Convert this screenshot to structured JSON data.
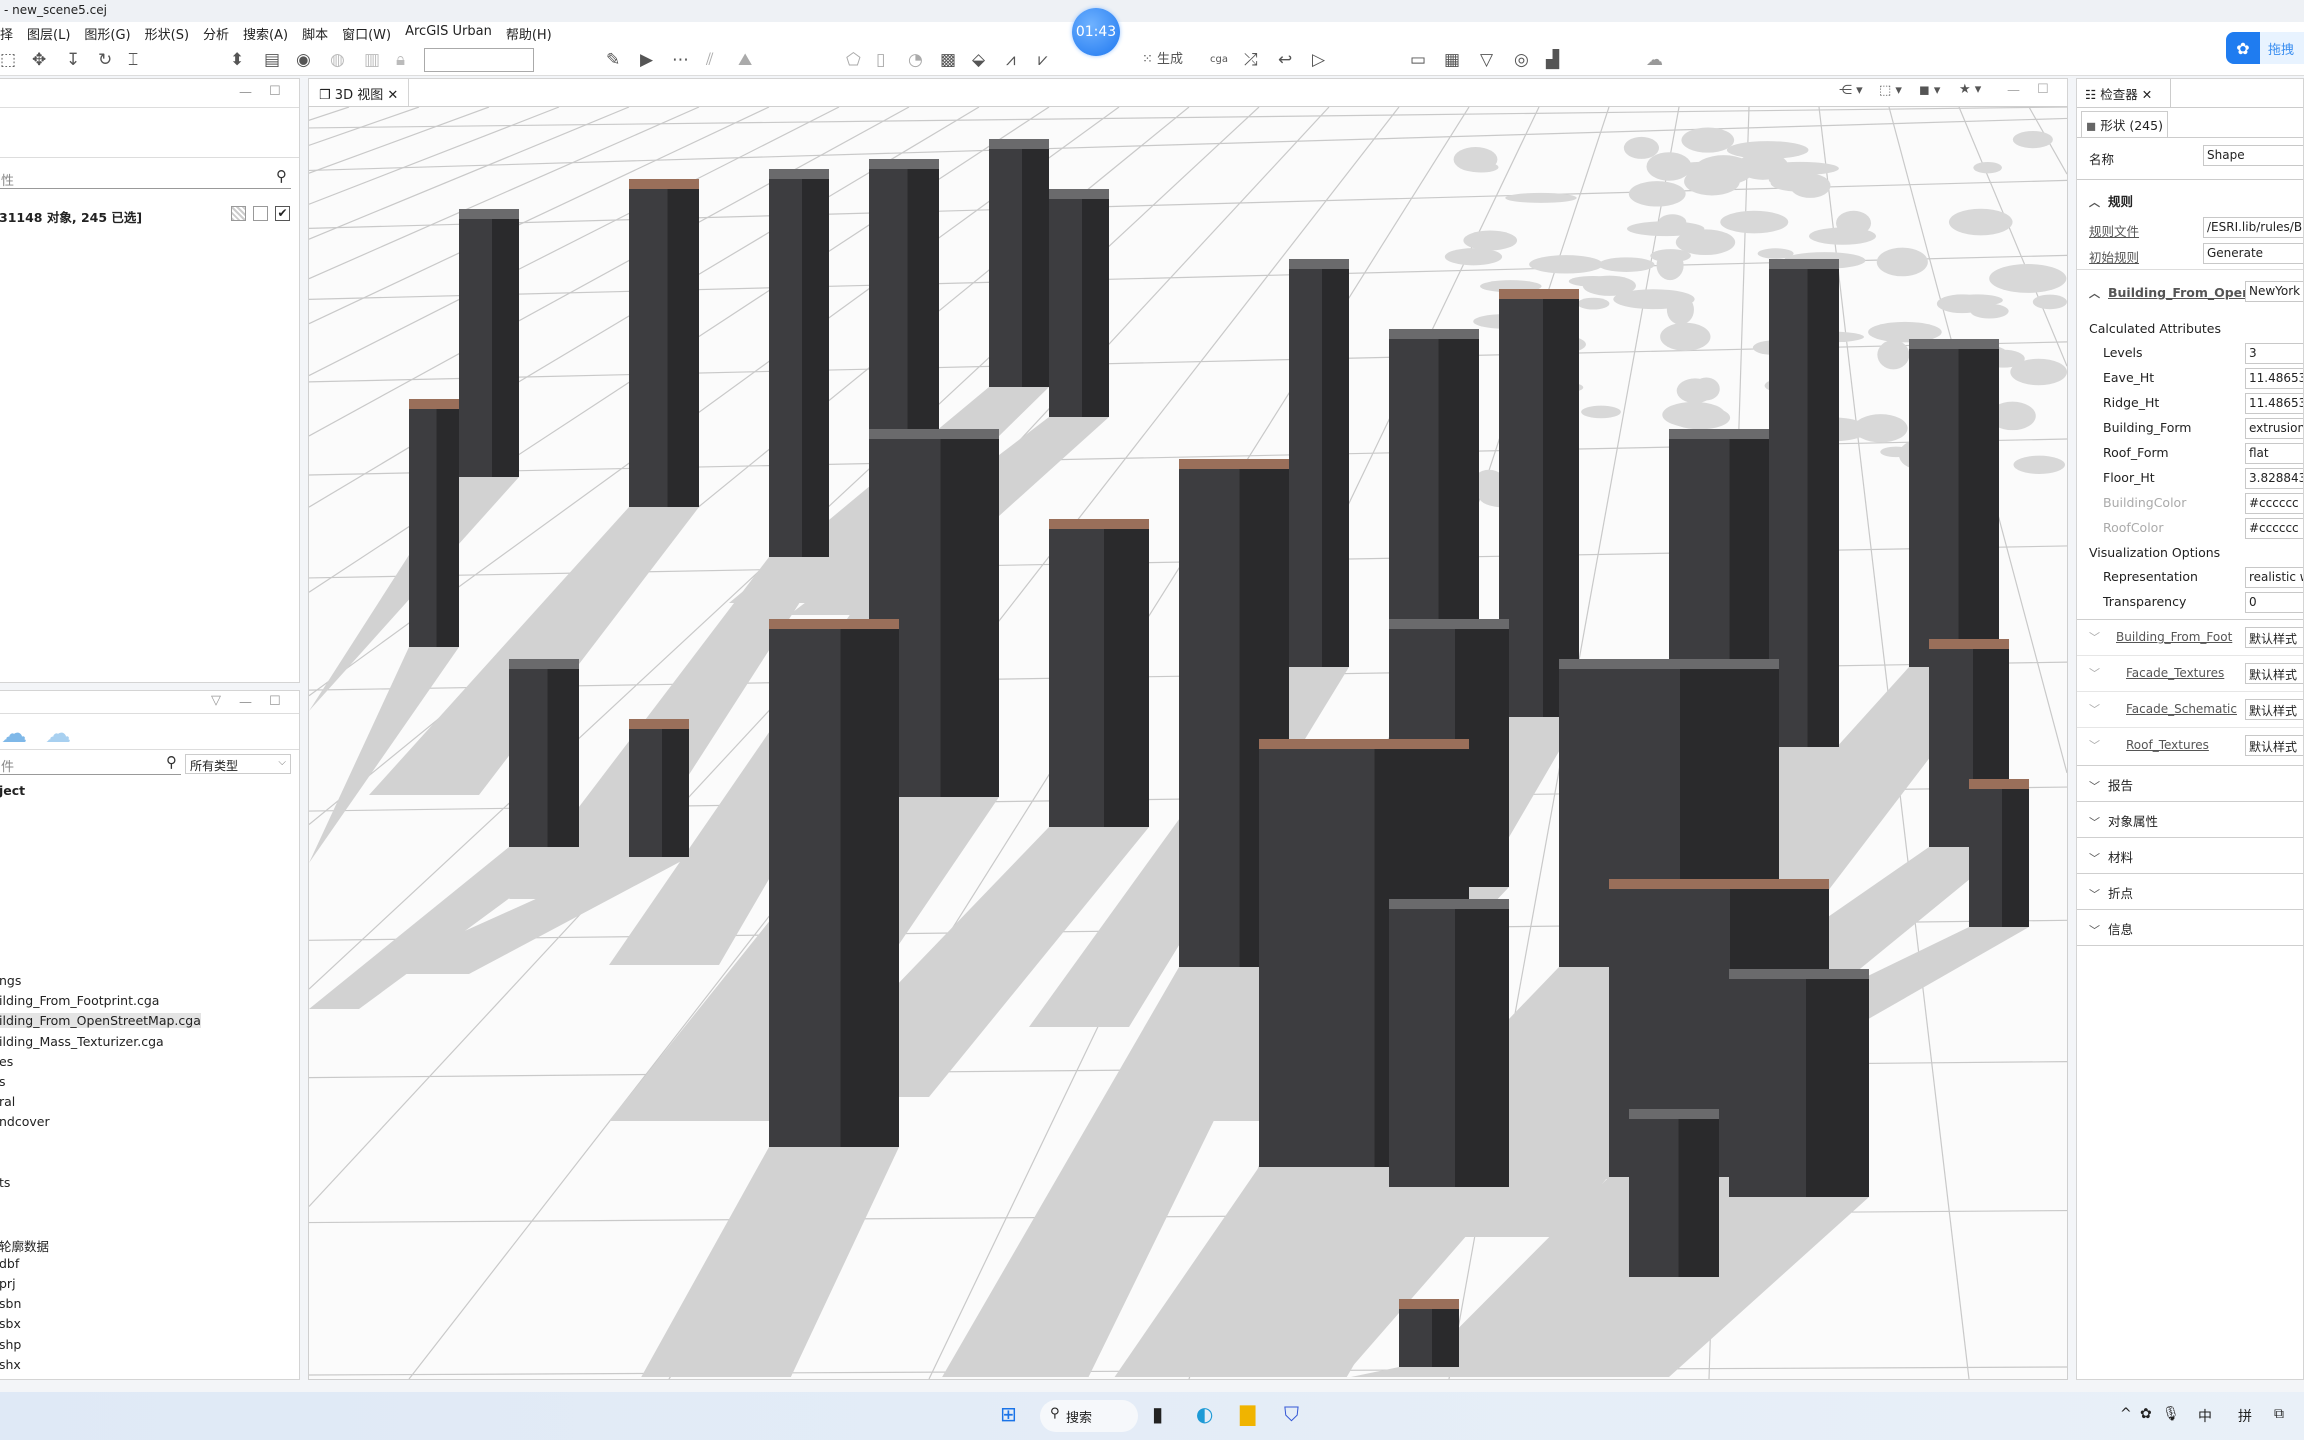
{
  "window": {
    "title": "- new_scene5.cej",
    "timer": "01:43"
  },
  "menu": [
    "择",
    "图层(L)",
    "图形(G)",
    "形状(S)",
    "分析",
    "搜索(A)",
    "脚本",
    "窗口(W)",
    "ArcGIS Urban",
    "帮助(H)"
  ],
  "toolbar": {
    "icons": [
      "frame-icon",
      "move-icon",
      "drop-icon",
      "rotate-icon",
      "fit-icon",
      "orbit-icon",
      "layers-icon",
      "tumble-icon",
      "globe-icon",
      "snap-icon",
      "lock-icon",
      "draw-polygon-icon",
      "select-icon",
      "edge-icon",
      "brush-icon",
      "terrain-icon",
      "shape-icon",
      "rectangle-icon",
      "circle-icon",
      "texture-icon",
      "paint-icon",
      "align-terrain-icon",
      "align-shape-icon"
    ],
    "coord_value": "",
    "generate_label": "生成",
    "cga_label": "cga",
    "right_icons": [
      "measure-icon",
      "measure-area-icon",
      "view-cone-icon",
      "viewshed-icon",
      "skyline-icon",
      "weather-icon"
    ],
    "baidu_label": "拖拽"
  },
  "left_top": {
    "search_placeholder": "性",
    "status": "31148 对象, 245 已选]"
  },
  "left_bottom": {
    "search_placeholder": "件",
    "type_filter": "所有类型",
    "root": "ject",
    "items": [
      "ngs",
      "ilding_From_Footprint.cga",
      "ilding_From_OpenStreetMap.cga",
      "ilding_Mass_Texturizer.cga",
      "es",
      "s",
      "ral",
      "ndcover",
      "",
      "",
      "ts",
      "",
      "",
      "轮廓数据",
      "dbf",
      "prj",
      "sbn",
      "sbx",
      "shp",
      "shx"
    ],
    "selected_index": 2
  },
  "viewport": {
    "tab_label": "3D 视图",
    "view_icons": [
      "share-icon",
      "object-icon",
      "camera-icon",
      "bookmark-star-icon"
    ]
  },
  "inspector": {
    "tab_label": "检查器",
    "shape_tab": "形状 (245)",
    "name_label": "名称",
    "name_value": "Shape",
    "rules_section": "规则",
    "rule_file_label": "规则文件",
    "rule_file_value": "/ESRI.lib/rules/Bu",
    "start_rule_label": "初始规则",
    "start_rule_value": "Generate",
    "rule_group": "Building_From_Open",
    "rule_group_value": "NewYork",
    "calc_header": "Calculated Attributes",
    "attrs": [
      {
        "label": "Levels",
        "value": "3",
        "dim": false
      },
      {
        "label": "Eave_Ht",
        "value": "11.48653",
        "dim": false
      },
      {
        "label": "Ridge_Ht",
        "value": "11.48653",
        "dim": false
      },
      {
        "label": "Building_Form",
        "value": "extrusion",
        "dim": false
      },
      {
        "label": "Roof_Form",
        "value": "flat",
        "dim": false
      },
      {
        "label": "Floor_Ht",
        "value": "3.828843",
        "dim": false
      },
      {
        "label": "BuildingColor",
        "value": "#cccccc",
        "dim": true
      },
      {
        "label": "RoofColor",
        "value": "#cccccc",
        "dim": true
      }
    ],
    "vis_header": "Visualization Options",
    "vis": [
      {
        "label": "Representation",
        "value": "realistic w"
      },
      {
        "label": "Transparency",
        "value": "0"
      }
    ],
    "sub_rules": [
      {
        "label": "Building_From_Foot",
        "value": "默认样式"
      },
      {
        "label": "Facade_Textures",
        "value": "默认样式"
      },
      {
        "label": "Facade_Schematic",
        "value": "默认样式"
      },
      {
        "label": "Roof_Textures",
        "value": "默认样式"
      }
    ],
    "sections": [
      "报告",
      "对象属性",
      "材料",
      "折点",
      "信息"
    ]
  },
  "taskbar": {
    "search_label": "搜索",
    "tray": [
      "^",
      "中",
      "拼"
    ],
    "apps": [
      "windows-start-icon",
      "task-view-icon",
      "edge-browser-icon",
      "file-explorer-icon",
      "cityengine-icon"
    ]
  }
}
